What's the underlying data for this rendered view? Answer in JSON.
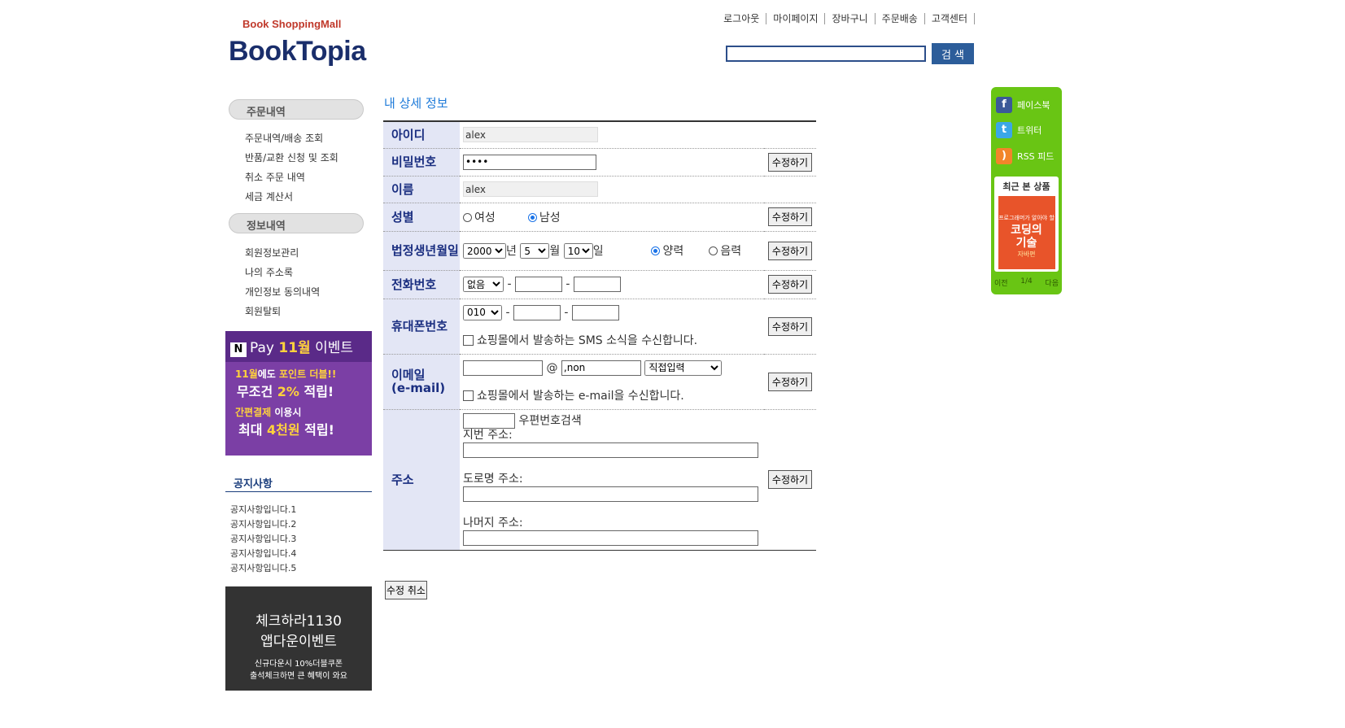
{
  "header": {
    "logo_sub": "Book ShoppingMall",
    "logo_main": "BookTopia",
    "nav": [
      "로그아웃",
      "마이페이지",
      "장바구니",
      "주문배송",
      "고객센터"
    ],
    "search_button": "검 색",
    "search_value": ""
  },
  "sidebar": {
    "section1": "주문내역",
    "section1_items": [
      "주문내역/배송 조회",
      "반품/교환 신청 및 조회",
      "취소 주문 내역",
      "세금 계산서"
    ],
    "section2": "정보내역",
    "section2_items": [
      "회원정보관리",
      "나의 주소록",
      "개인정보 동의내역",
      "회원탈퇴"
    ],
    "banner1": {
      "pay": "Pay",
      "month": "11월",
      "event": "이벤트",
      "line1_a": "11월",
      "line1_b": "에도 ",
      "line1_c": "포인트 더블!!",
      "line2_a": "무조건 ",
      "line2_b": "2%",
      "line2_c": " 적립!",
      "line3_a": "간편결제",
      "line3_b": " 이용시",
      "line4_a": "최대 ",
      "line4_b": "4천원",
      "line4_c": " 적립!"
    },
    "notice_title": "공지사항",
    "notices": [
      "공지사항입니다.1",
      "공지사항입니다.2",
      "공지사항입니다.3",
      "공지사항입니다.4",
      "공지사항입니다.5"
    ],
    "banner2": {
      "line1": "체크하라1130",
      "line2": "앱다운이벤트",
      "line3": "신규다운시 10%더블쿠폰",
      "line4": "출석체크하면 큰 혜택이 와요"
    }
  },
  "main": {
    "title": "내 상세 정보",
    "edit_label": "수정하기",
    "cancel_label": "수정 취소",
    "rows": {
      "id": {
        "label": "아이디",
        "value": "alex"
      },
      "password": {
        "label": "비밀번호",
        "value": "••••"
      },
      "name": {
        "label": "이름",
        "value": "alex"
      },
      "gender": {
        "label": "성별",
        "female": "여성",
        "male": "남성",
        "selected": "남성"
      },
      "birth": {
        "label": "법정생년월일",
        "year": "2000",
        "year_unit": "년",
        "month": "5",
        "month_unit": "월",
        "day": "10",
        "day_unit": "일",
        "solar": "양력",
        "lunar": "음력",
        "selected": "양력"
      },
      "phone": {
        "label": "전화번호",
        "area": "없음",
        "dash": "-"
      },
      "mobile": {
        "label": "휴대폰번호",
        "prefix": "010",
        "dash": "-",
        "sms_text": "쇼핑몰에서 발송하는 SMS 소식을 수신합니다."
      },
      "email": {
        "label_1": "이메일",
        "label_2": "(e-mail)",
        "at": "@",
        "domain": ",non",
        "domain_select": "직접입력",
        "email_text": "쇼핑몰에서 발송하는 e-mail을 수신합니다."
      },
      "address": {
        "label": "주소",
        "zip_search": "우편번호검색",
        "jibun": "지번 주소:",
        "road": "도로명 주소:",
        "rest": "나머지 주소:"
      }
    }
  },
  "right_panel": {
    "facebook": "페이스북",
    "twitter": "트위터",
    "rss": "RSS 피드",
    "recent_title": "최근 본 상품",
    "book_sub": "프로그래머가 알아야 할",
    "book_title_1": "코딩의",
    "book_title_2": "기술",
    "book_author": "자바편",
    "prev": "이전",
    "page": "1/4",
    "next": "다음"
  },
  "colors": {
    "brand": "#1a2e6b",
    "accent": "#1d7ad9",
    "label_bg": "#e3e6f5",
    "panel_green": "#69c514",
    "search_btn": "#2c5d9a"
  }
}
